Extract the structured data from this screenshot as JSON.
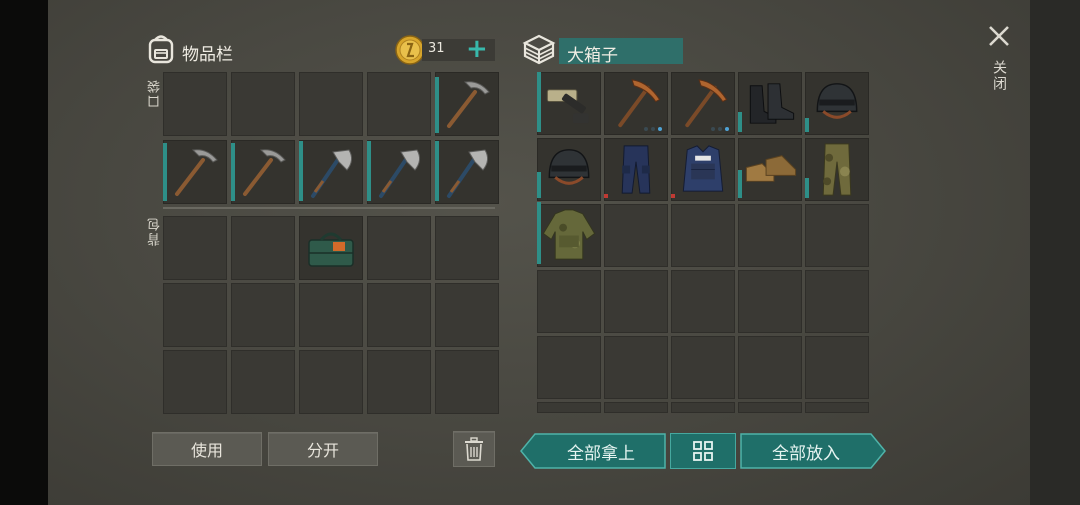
{
  "inventory": {
    "title": "物品栏",
    "coins": "31",
    "pocket_label": "口袋",
    "backpack_label": "背包"
  },
  "container": {
    "title": "大箱子"
  },
  "close_label": "关闭",
  "buttons": {
    "use": "使用",
    "split": "分开",
    "take_all": "全部拿上",
    "put_all": "全部放入"
  },
  "pocket_items": [
    "",
    "",
    "",
    "",
    "pickaxe",
    "pickaxe",
    "pickaxe",
    "hatchet",
    "hatchet",
    "hatchet"
  ],
  "backpack_items": [
    "",
    "",
    "toolbox",
    "",
    "",
    "",
    "",
    "",
    "",
    "",
    "",
    "",
    "",
    "",
    ""
  ],
  "container_items": [
    "rifle-parts",
    "pickaxe-copper",
    "pickaxe-copper",
    "boots",
    "helmet",
    "helmet",
    "pants-blue",
    "vest-blue",
    "shoes",
    "pants-camo",
    "jacket-camo"
  ],
  "colors": {
    "accent": "#2e8f88",
    "panel": "#4a4942",
    "button_teal": "#1f6f69"
  }
}
